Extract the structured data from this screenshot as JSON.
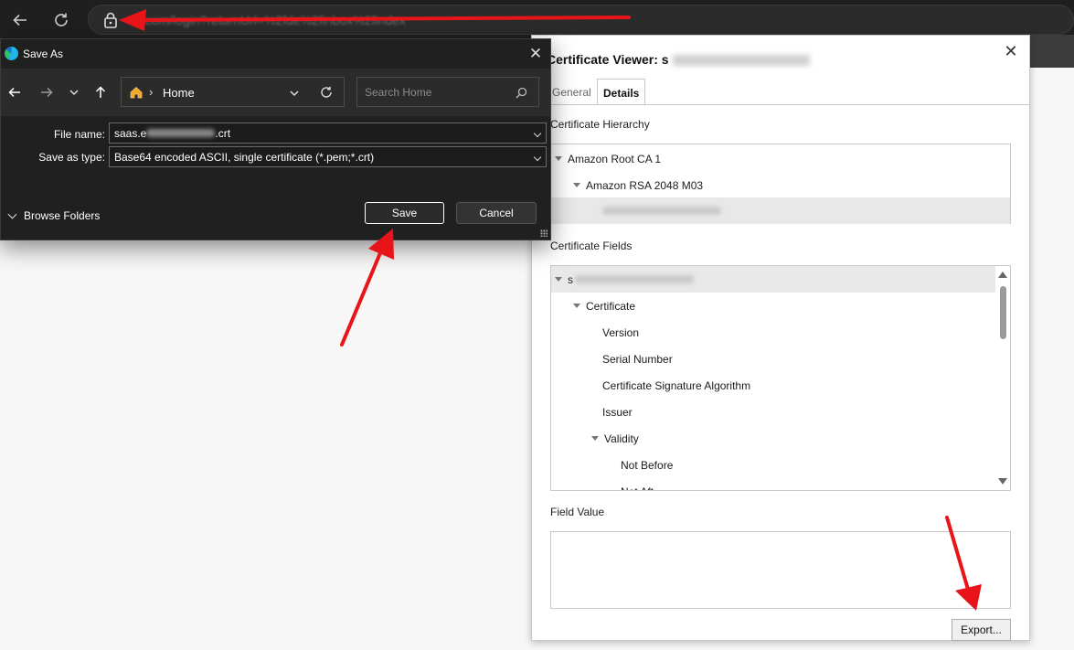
{
  "browser": {
    "back_icon": "arrow-left-icon",
    "refresh_icon": "refresh-icon",
    "lock_icon": "lock-icon",
    "url_visible_suffix": "...com/login?returnUrl=%2fde%2finbox%2findex"
  },
  "save_dialog": {
    "title": "Save As",
    "nav": {
      "back": "arrow-left-icon",
      "forward": "arrow-right-icon",
      "recent": "chevron-down-icon",
      "up": "arrow-up-icon"
    },
    "path": {
      "location": "Home",
      "separator": "›"
    },
    "search_placeholder": "Search Home",
    "file_name_label": "File name:",
    "file_name_value_prefix": "saas.e",
    "file_name_value_suffix": ".crt",
    "save_as_type_label": "Save as type:",
    "save_as_type_value": "Base64 encoded ASCII, single certificate (*.pem;*.crt)",
    "browse_folders_label": "Browse Folders",
    "save_label": "Save",
    "cancel_label": "Cancel"
  },
  "cert_viewer": {
    "title": "Certificate Viewer: s",
    "tabs": [
      {
        "label": "General",
        "active": false
      },
      {
        "label": "Details",
        "active": true
      }
    ],
    "hierarchy_label": "Certificate Hierarchy",
    "hierarchy": [
      {
        "label": "Amazon Root CA 1",
        "expanded": true
      },
      {
        "label": "Amazon RSA 2048 M03",
        "expanded": true
      }
    ],
    "fields_label": "Certificate Fields",
    "fields": [
      {
        "label": "s",
        "expanded": true
      },
      {
        "label": "Certificate",
        "expanded": true
      },
      {
        "label": "Version"
      },
      {
        "label": "Serial Number"
      },
      {
        "label": "Certificate Signature Algorithm"
      },
      {
        "label": "Issuer"
      },
      {
        "label": "Validity",
        "expanded": true
      },
      {
        "label": "Not Before"
      },
      {
        "label": "Not Aft"
      }
    ],
    "field_value_label": "Field Value",
    "export_label": "Export..."
  },
  "annotation_color": "#e8141a"
}
